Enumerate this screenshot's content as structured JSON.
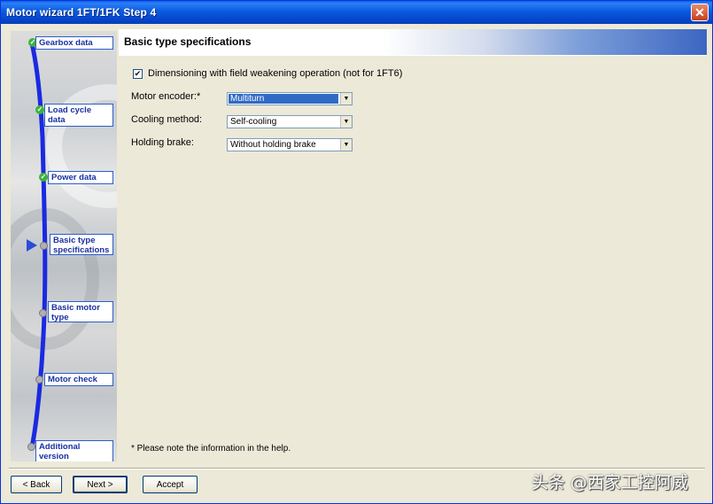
{
  "window": {
    "title": "Motor wizard 1FT/1FK   Step 4",
    "close_glyph": "✕"
  },
  "header": {
    "title": "Basic type specifications"
  },
  "nav": {
    "steps": [
      {
        "label": "Gearbox data",
        "state": "done"
      },
      {
        "label": "Load cycle data",
        "state": "done"
      },
      {
        "label": "Power data",
        "state": "done"
      },
      {
        "label": "Basic type specifications",
        "state": "current"
      },
      {
        "label": "Basic motor type",
        "state": "pending"
      },
      {
        "label": "Motor check",
        "state": "pending"
      },
      {
        "label": "Additional version",
        "state": "pending"
      }
    ],
    "line_color": "#1a2ae0",
    "done_color": "#3bb33b"
  },
  "form": {
    "field_weakening": {
      "label": "Dimensioning with field weakening operation (not for 1FT6)",
      "checked": true
    },
    "motor_encoder": {
      "label": "Motor encoder:*",
      "value": "Multiturn"
    },
    "cooling_method": {
      "label": "Cooling method:",
      "value": "Self-cooling"
    },
    "holding_brake": {
      "label": "Holding brake:",
      "value": "Without holding brake"
    },
    "note": "* Please note the information in the help."
  },
  "buttons": {
    "back": "< Back",
    "next": "Next >",
    "accept": "Accept"
  },
  "watermark": {
    "text": "头条 @西家工控阿威"
  }
}
